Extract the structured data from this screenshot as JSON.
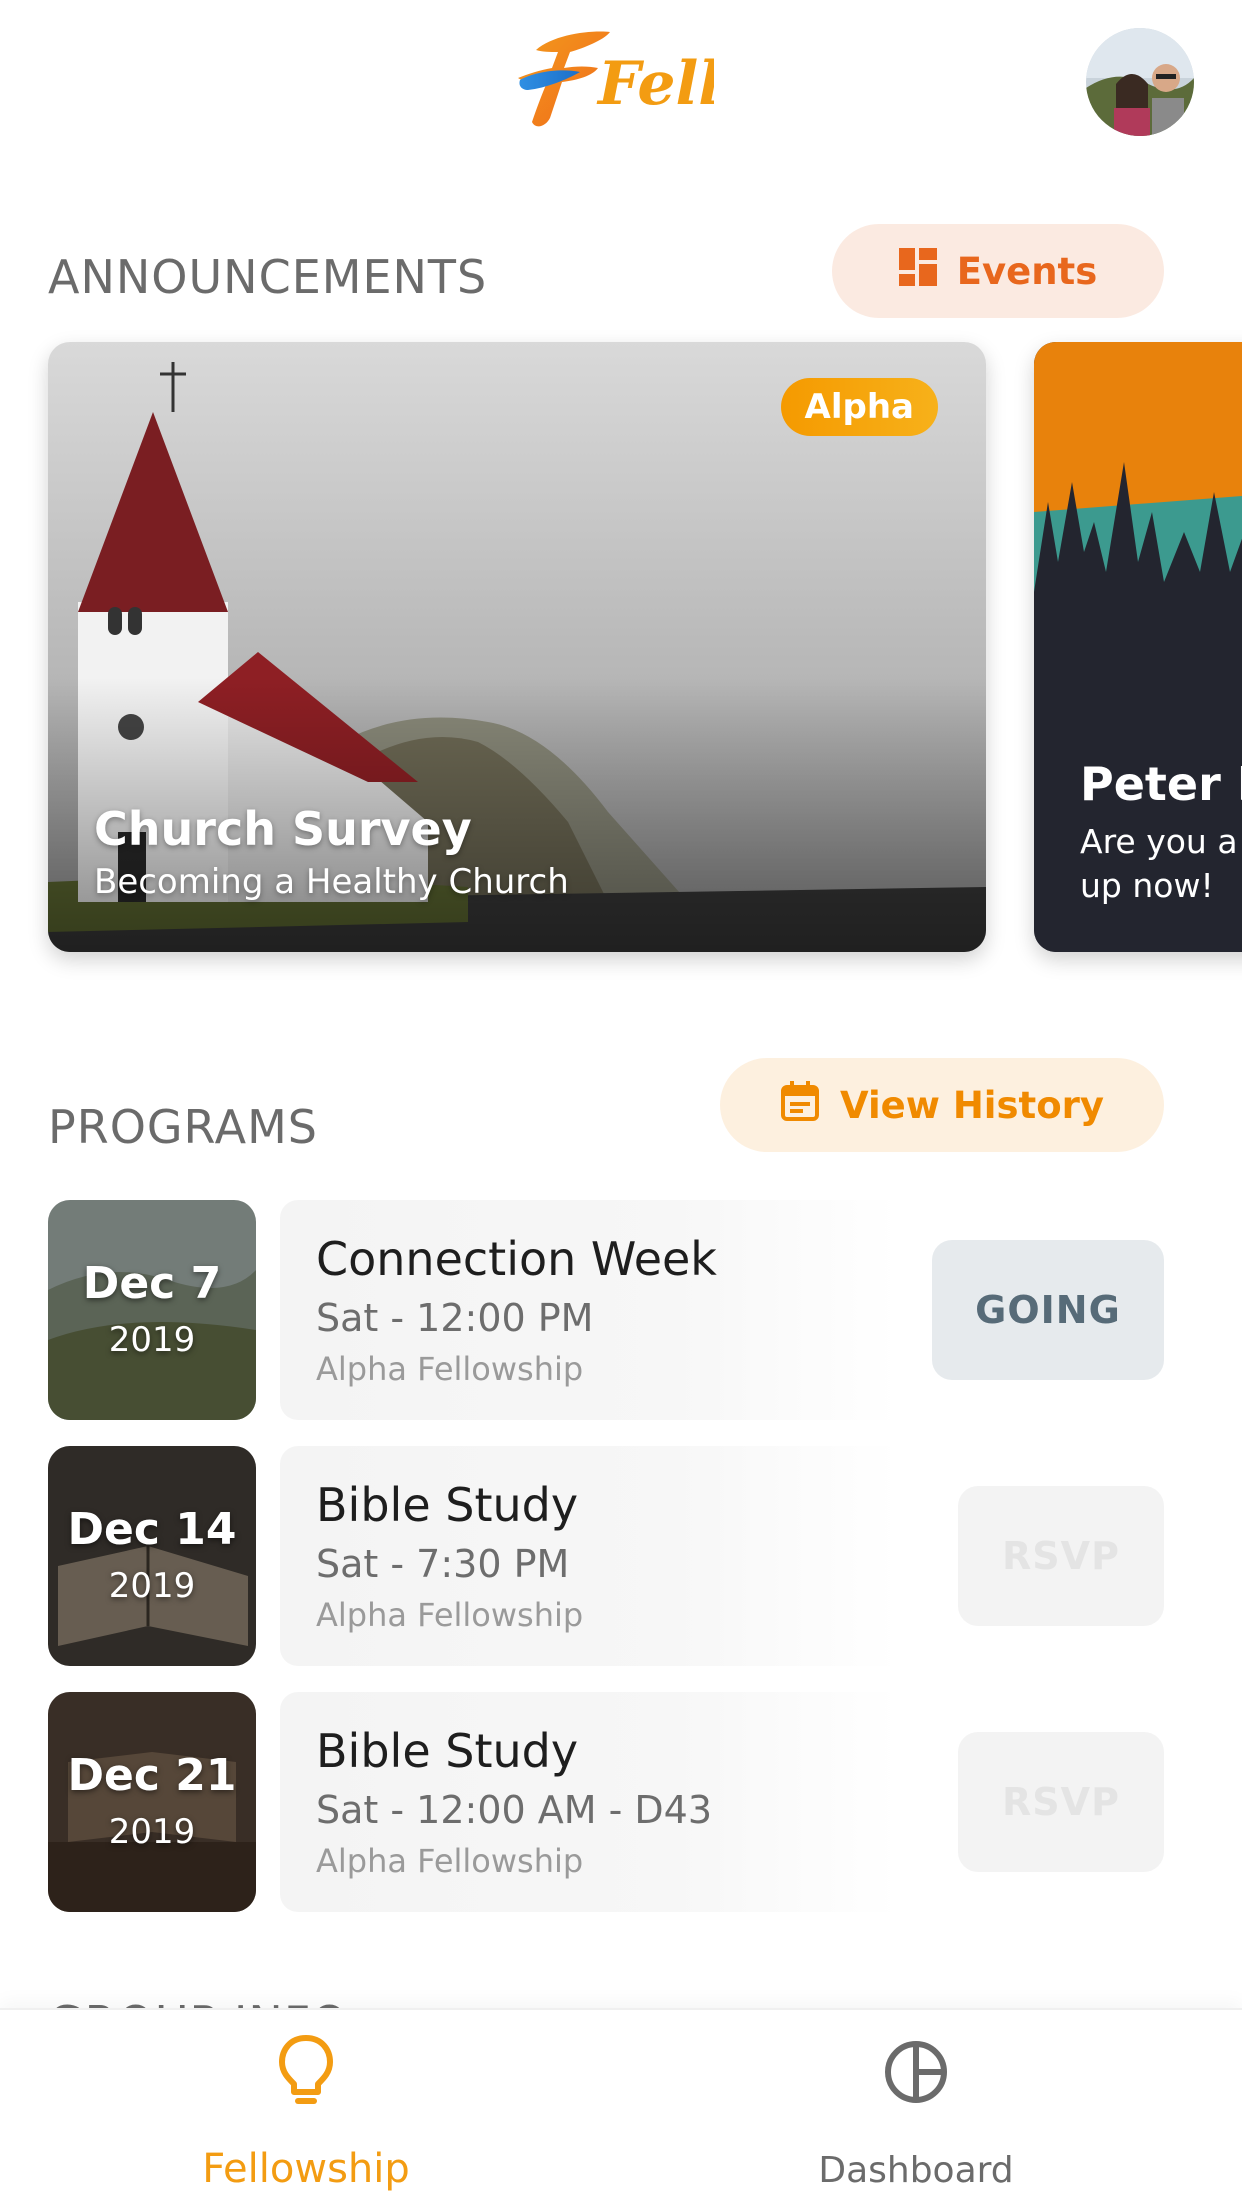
{
  "header": {
    "logo_text": "Fella"
  },
  "announcements": {
    "heading": "ANNOUNCEMENTS",
    "events_button": "Events",
    "cards": [
      {
        "tag": "Alpha",
        "title": "Church Survey",
        "subtitle": "Becoming a Healthy Church"
      },
      {
        "title": "Peter F",
        "text": "Are you a\nup now!"
      }
    ]
  },
  "programs": {
    "heading": "PROGRAMS",
    "history_button": "View History",
    "items": [
      {
        "day": "Dec 7",
        "year": "2019",
        "name": "Connection Week",
        "time": "Sat - 12:00 PM",
        "group": "Alpha Fellowship",
        "action": "GOING"
      },
      {
        "day": "Dec 14",
        "year": "2019",
        "name": "Bible Study",
        "time": "Sat - 7:30 PM",
        "group": "Alpha Fellowship",
        "action": "RSVP"
      },
      {
        "day": "Dec 21",
        "year": "2019",
        "name": "Bible Study",
        "time": "Sat - 12:00 AM - D43",
        "group": "Alpha Fellowship",
        "action": "RSVP"
      }
    ]
  },
  "group_info": {
    "heading": "GROUP INFO"
  },
  "nav": {
    "items": [
      {
        "label": "Fellowship",
        "icon": "lightbulb-icon",
        "active": true
      },
      {
        "label": "Dashboard",
        "icon": "pie-chart-icon",
        "active": false
      }
    ]
  },
  "colors": {
    "accent": "#f39c12",
    "events_bg": "#fbeae1",
    "history_bg": "#fdf0df",
    "going_bg": "#e6eaed"
  }
}
